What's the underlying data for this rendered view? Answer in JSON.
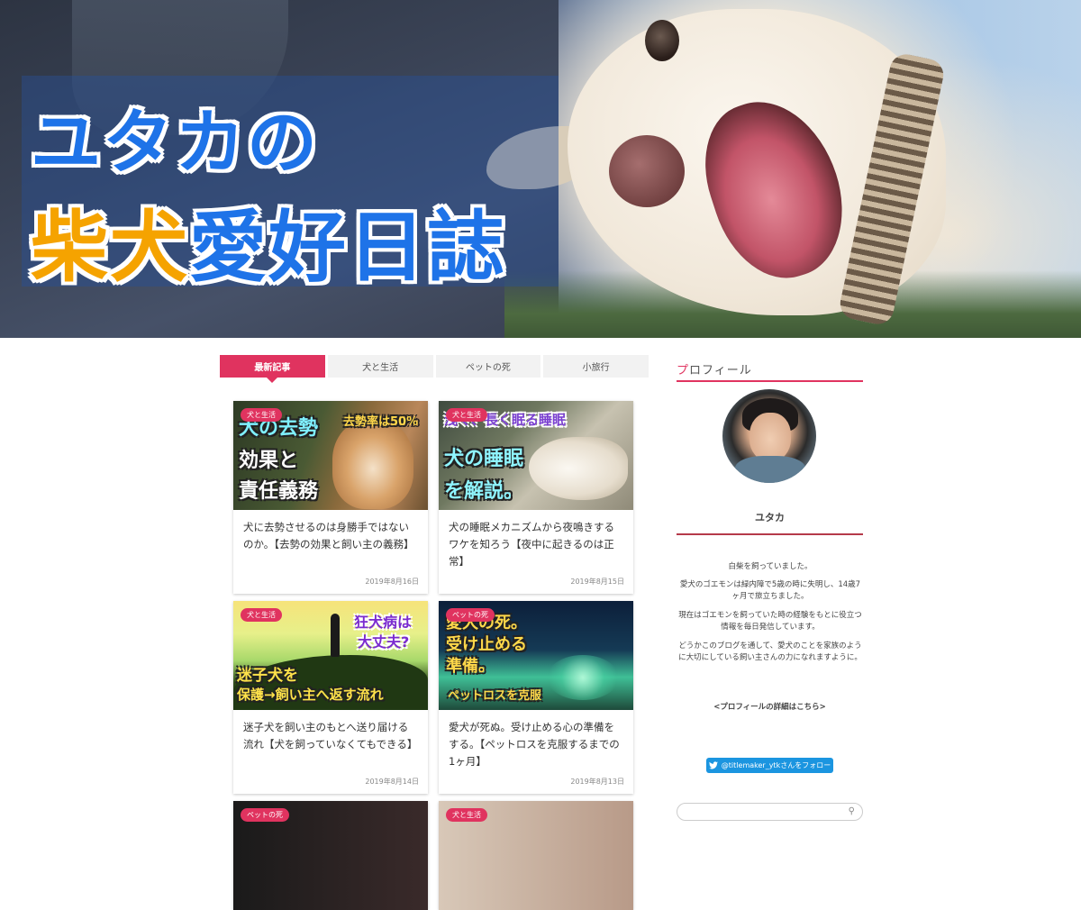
{
  "header": {
    "title_line1": "ユタカの",
    "title_line2_orange": "柴犬",
    "title_line2_blue": "愛好日誌"
  },
  "tabs": [
    {
      "label": "最新記事",
      "active": true
    },
    {
      "label": "犬と生活",
      "active": false
    },
    {
      "label": "ペットの死",
      "active": false
    },
    {
      "label": "小旅行",
      "active": false
    }
  ],
  "articles": [
    {
      "category": "犬と生活",
      "thumb_text": [
        "犬の去勢",
        "効果と",
        "責任義務",
        "去勢率は50%"
      ],
      "title": "犬に去勢させるのは身勝手ではないのか。【去勢の効果と飼い主の義務】",
      "date": "2019年8月16日"
    },
    {
      "category": "犬と生活",
      "thumb_text": [
        "浅く、長く眠る睡眠",
        "犬の睡眠",
        "を解説。"
      ],
      "title": "犬の睡眠メカニズムから夜鳴きするワケを知ろう【夜中に起きるのは正常】",
      "date": "2019年8月15日"
    },
    {
      "category": "犬と生活",
      "thumb_text": [
        "狂犬病は",
        "大丈夫?",
        "迷子犬を",
        "保護→飼い主へ返す流れ"
      ],
      "title": "迷子犬を飼い主のもとへ送り届ける流れ【犬を飼っていなくてもできる】",
      "date": "2019年8月14日"
    },
    {
      "category": "ペットの死",
      "thumb_text": [
        "愛犬の死。",
        "受け止める",
        "準備。",
        "ペットロスを克服"
      ],
      "title": "愛犬が死ぬ。受け止める心の準備をする。【ペットロスを克服するまでの1ヶ月】",
      "date": "2019年8月13日"
    },
    {
      "category": "ペットの死"
    },
    {
      "category": "犬と生活"
    }
  ],
  "sidebar": {
    "heading_first": "プ",
    "heading_rest": "ロフィール",
    "name": "ユタカ",
    "paragraphs": [
      "白柴を飼っていました。",
      "愛犬のゴエモンは緑内障で5歳の時に失明し、14歳7ヶ月で旅立ちました。",
      "現在はゴエモンを飼っていた時の経験をもとに役立つ情報を毎日発信しています。",
      "どうかこのブログを通して、愛犬のことを家族のように大切にしている飼い主さんの力になれますように。"
    ],
    "profile_link": "<プロフィールの詳細はこちら>",
    "follow_label": "@titlemaker_ytkさんをフォロー"
  },
  "colors": {
    "accent": "#e0335f",
    "title_blue": "#1e73e8",
    "title_orange": "#f5a300",
    "twitter": "#1b95e0"
  }
}
